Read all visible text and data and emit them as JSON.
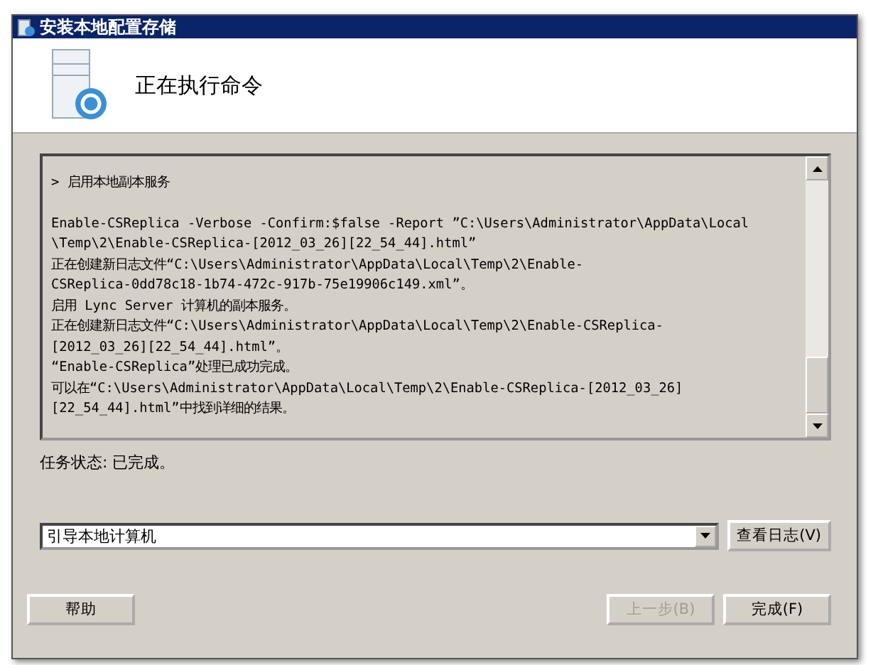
{
  "window": {
    "title": "安装本地配置存储"
  },
  "header": {
    "title": "正在执行命令"
  },
  "log": {
    "section": "> 启用本地副本服务",
    "lines": [
      "Enable-CSReplica -Verbose -Confirm:$false -Report ”C:\\Users\\Administrator\\AppData\\Local",
      "\\Temp\\2\\Enable-CSReplica-[2012_03_26][22_54_44].html”",
      "正在创建新日志文件“C:\\Users\\Administrator\\AppData\\Local\\Temp\\2\\Enable-",
      "CSReplica-0dd78c18-1b74-472c-917b-75e19906c149.xml”。",
      "启用 Lync Server 计算机的副本服务。",
      "正在创建新日志文件“C:\\Users\\Administrator\\AppData\\Local\\Temp\\2\\Enable-CSReplica-",
      "[2012_03_26][22_54_44].html”。",
      "“Enable-CSReplica”处理已成功完成。",
      "可以在“C:\\Users\\Administrator\\AppData\\Local\\Temp\\2\\Enable-CSReplica-[2012_03_26]",
      "[22_54_44].html”中找到详细的结果。"
    ]
  },
  "status": "任务状态: 已完成。",
  "dropdown": {
    "value": "引导本地计算机"
  },
  "view_log_button": "查看日志(V)",
  "buttons": [
    {
      "label": "帮助",
      "disabled": false
    },
    {
      "label": "上一步(B)",
      "disabled": true
    },
    {
      "label": "完成(F)",
      "disabled": false
    }
  ]
}
